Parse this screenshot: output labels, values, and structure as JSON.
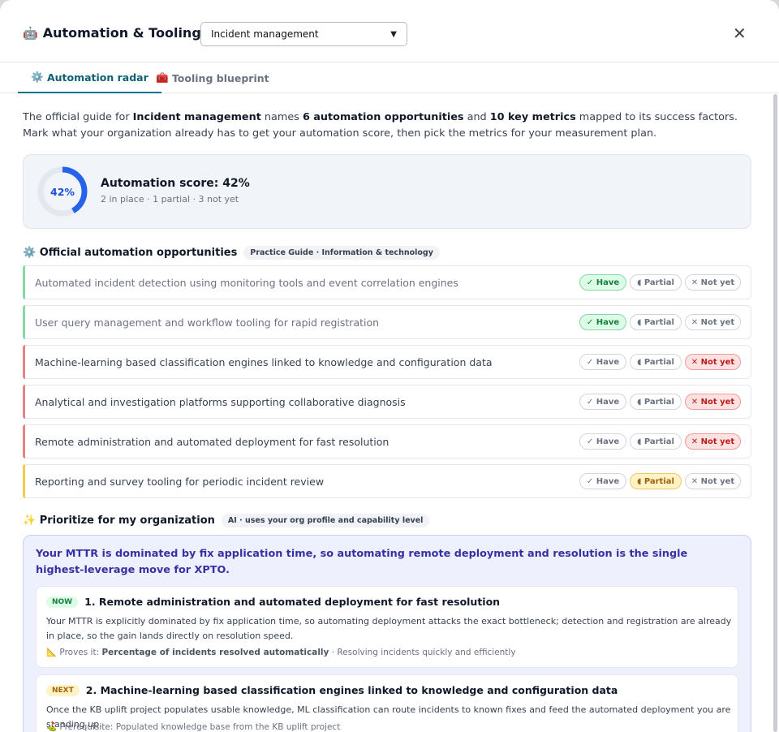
{
  "header": {
    "icon": "🤖",
    "title": "Automation & Tooling",
    "practice_select": "Incident management",
    "close_label": "✕"
  },
  "tabs": [
    {
      "icon": "⚙️",
      "label": "Automation radar",
      "active": true
    },
    {
      "icon": "🧰",
      "label": "Tooling blueprint",
      "active": false
    }
  ],
  "intro": {
    "p1": "The official guide for ",
    "practice": "Incident management",
    "p2": " names ",
    "count_opps": "6 automation opportunities",
    "p3": " and ",
    "count_metrics": "10 key metrics",
    "p4": " mapped to its success factors. Mark what your organization already has to get your automation score, then pick the metrics for your measurement plan."
  },
  "score": {
    "percent_label": "42%",
    "percent_value": 0.42,
    "title": "Automation score: 42%",
    "summary": "2 in place · 1 partial · 3 not yet",
    "accent": "#2563eb"
  },
  "opportunities_section": {
    "icon": "⚙️",
    "title": "Official automation opportunities",
    "chip": "Practice Guide · Information & technology"
  },
  "state_labels": {
    "have": "✓ Have",
    "partial": "◖ Partial",
    "notyet": "✕ Not yet"
  },
  "opportunities": [
    {
      "text": "Automated incident detection using monitoring tools and event correlation engines",
      "state": "have"
    },
    {
      "text": "User query management and workflow tooling for rapid registration",
      "state": "have"
    },
    {
      "text": "Machine-learning based classification engines linked to knowledge and configuration data",
      "state": "notyet"
    },
    {
      "text": "Analytical and investigation platforms supporting collaborative diagnosis",
      "state": "notyet"
    },
    {
      "text": "Remote administration and automated deployment for fast resolution",
      "state": "notyet"
    },
    {
      "text": "Reporting and survey tooling for periodic incident review",
      "state": "partial"
    }
  ],
  "state_colors": {
    "have": "#86d9a4",
    "partial": "#f5c94a",
    "notyet": "#e58484"
  },
  "prioritize_section": {
    "icon": "✨",
    "title": "Prioritize for my organization",
    "chip": "AI · uses your org profile and capability level"
  },
  "prioritize": {
    "headline": "Your MTTR is dominated by fix application time, so automating remote deployment and resolution is the single highest-leverage move for XPTO.",
    "recommendations": [
      {
        "badge": "NOW",
        "title": "1. Remote administration and automated deployment for fast resolution",
        "body": "Your MTTR is explicitly dominated by fix application time, so automating deployment attacks the exact bottleneck; detection and registration are already in place, so the gain lands directly on resolution speed.",
        "foot_icon": "📐",
        "foot_label": "Proves it: ",
        "foot_metric": "Percentage of incidents resolved automatically",
        "foot_tail": " · Resolving incidents quickly and efficiently"
      },
      {
        "badge": "NEXT",
        "title": "2. Machine-learning based classification engines linked to knowledge and configuration data",
        "body": "Once the KB uplift project populates usable knowledge, ML classification can route incidents to known fixes and feed the automated deployment you are standing up.",
        "foot_icon": "⛳",
        "foot_label": "Prerequisite: Populated knowledge base from the KB uplift project"
      }
    ]
  }
}
